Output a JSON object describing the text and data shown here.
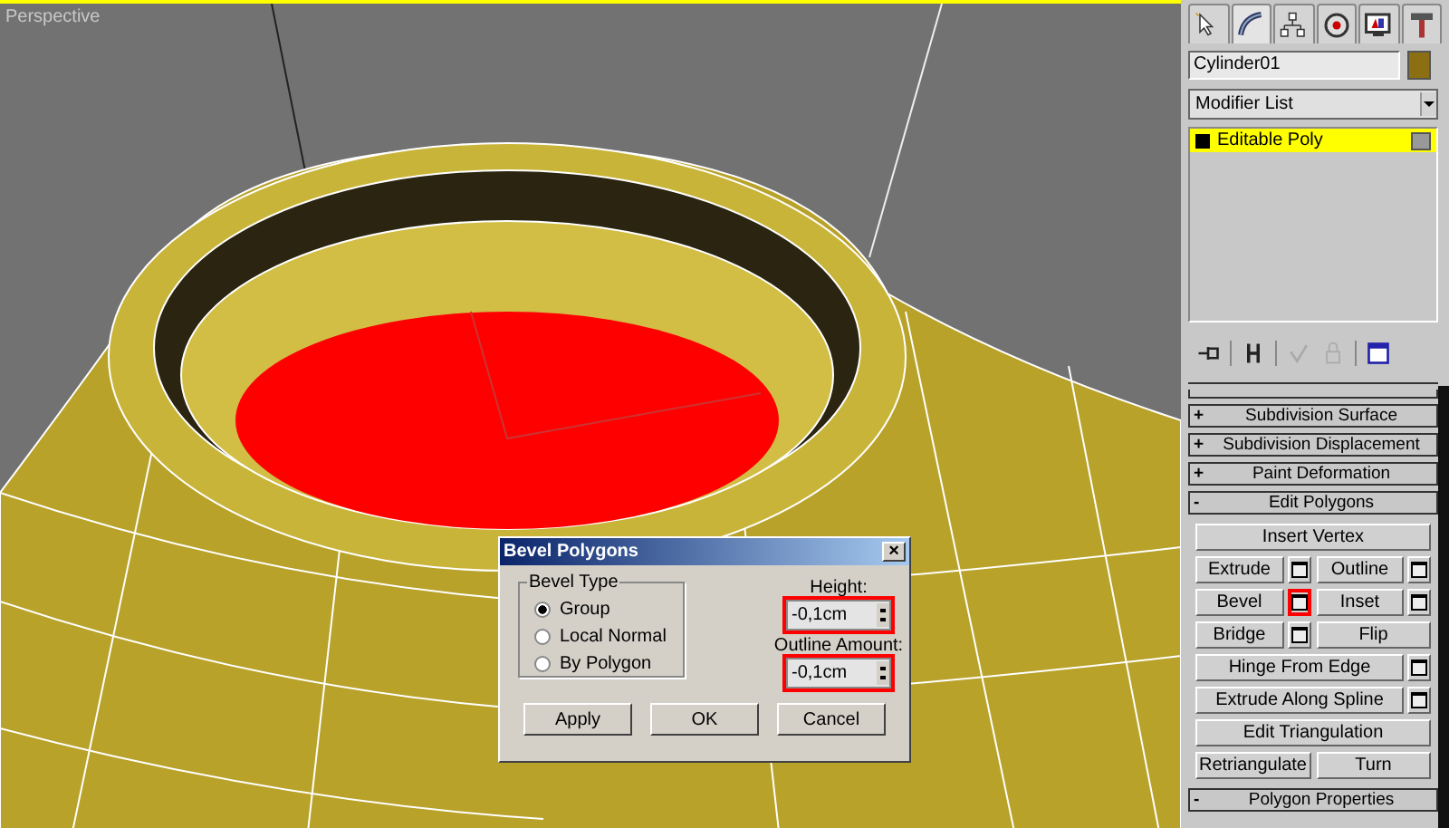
{
  "viewport": {
    "label": "Perspective"
  },
  "command_panel": {
    "tabs": [
      {
        "selected": false
      },
      {
        "selected": true
      },
      {
        "selected": false
      },
      {
        "selected": false
      },
      {
        "selected": false
      },
      {
        "selected": false
      }
    ],
    "object_name": "Cylinder01",
    "modifier_list": "Modifier List",
    "stack": [
      {
        "label": "Editable Poly",
        "selected": true
      }
    ],
    "rollouts": [
      {
        "title": "Subdivision Surface",
        "sign": "+"
      },
      {
        "title": "Subdivision Displacement",
        "sign": "+"
      },
      {
        "title": "Paint Deformation",
        "sign": "+"
      },
      {
        "title": "Edit Polygons",
        "sign": "-",
        "rows": [
          [
            {
              "label": "Insert Vertex"
            }
          ],
          [
            {
              "label": "Extrude",
              "settings": {
                "highlighted": false
              }
            },
            {
              "label": "Outline",
              "settings": {
                "highlighted": false
              }
            }
          ],
          [
            {
              "label": "Bevel",
              "settings": {
                "highlighted": true
              }
            },
            {
              "label": "Inset",
              "settings": {
                "highlighted": false
              }
            }
          ],
          [
            {
              "label": "Bridge",
              "settings": {
                "highlighted": false
              }
            },
            {
              "label": "Flip"
            }
          ],
          [
            {
              "label": "Hinge From Edge",
              "settings": {
                "highlighted": false
              }
            }
          ],
          [
            {
              "label": "Extrude Along Spline",
              "settings": {
                "highlighted": false
              }
            }
          ],
          [
            {
              "label": "Edit Triangulation"
            }
          ],
          [
            {
              "label": "Retriangulate"
            },
            {
              "label": "Turn"
            }
          ]
        ]
      },
      {
        "title": "Polygon Properties",
        "sign": "-"
      }
    ]
  },
  "dialog": {
    "title": "Bevel Polygons",
    "close": "×",
    "group_title": "Bevel Type",
    "options": [
      {
        "label": "Group",
        "selected": true
      },
      {
        "label": "Local Normal",
        "selected": false
      },
      {
        "label": "By Polygon",
        "selected": false
      }
    ],
    "fields": [
      {
        "label": "Height:",
        "value": "-0,1cm",
        "highlighted": true
      },
      {
        "label": "Outline Amount:",
        "value": "-0,1cm",
        "highlighted": true
      }
    ],
    "buttons": [
      "Apply",
      "OK",
      "Cancel"
    ]
  }
}
